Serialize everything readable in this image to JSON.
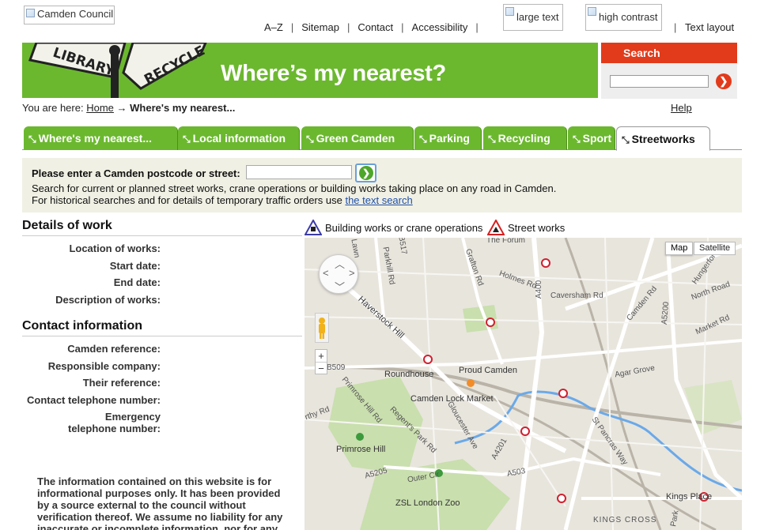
{
  "header": {
    "logo_alt": "Camden Council",
    "util_links": [
      "A–Z",
      "Sitemap",
      "Contact",
      "Accessibility"
    ],
    "large_text_alt": "large text",
    "high_contrast_alt": "high contrast",
    "text_layout": "Text layout"
  },
  "banner": {
    "sign_words": [
      "LIBRARY",
      "RECYCLE"
    ],
    "title": "Where’s my nearest?"
  },
  "search": {
    "heading": "Search",
    "placeholder": "",
    "go_glyph": "❯"
  },
  "breadcrumb": {
    "prefix": "You are here:",
    "home": "Home",
    "arrow": "→",
    "current": "Where's my nearest..."
  },
  "help": "Help",
  "tabs": [
    {
      "label": "Where's my nearest...",
      "active": false
    },
    {
      "label": "Local information",
      "active": false
    },
    {
      "label": "Green Camden",
      "active": false
    },
    {
      "label": "Parking",
      "active": false
    },
    {
      "label": "Recycling",
      "active": false
    },
    {
      "label": "Sport",
      "active": false
    },
    {
      "label": "Streetworks",
      "active": true
    }
  ],
  "postcode": {
    "label": "Please enter a Camden postcode or street:",
    "value": "",
    "desc1": "Search for current or planned street works, crane operations or building works taking place on any road in Camden.",
    "desc2_prefix": "For historical searches and for details of temporary traffic orders use",
    "desc2_link": "the text search"
  },
  "details": {
    "title": "Details of work",
    "fields": [
      "Location of works:",
      "Start date:",
      "End date:",
      "Description of works:"
    ]
  },
  "contact": {
    "title": "Contact information",
    "fields": [
      "Camden reference:",
      "Responsible company:",
      "Their reference:",
      "Contact telephone number:",
      "Emergency telephone number:"
    ]
  },
  "disclaimer": "The information contained on this website is for informational purposes only. It has been provided by a source external to the council without verification thereof. We assume no liability for any inaccurate or incomplete information, nor for any",
  "legend": {
    "building": "Building works or crane operations",
    "street": "Street works",
    "colors": {
      "building": "#3c3ca8",
      "street": "#d62020"
    }
  },
  "map": {
    "type_map": "Map",
    "type_satellite": "Satellite",
    "zoom_in": "+",
    "zoom_out": "−",
    "labels": [
      "The Forum",
      "Parkhill Rd",
      "B517",
      "Grafton Rd",
      "Holmes Rd",
      "Caversham Rd",
      "A400",
      "Haverstock Hill",
      "Camden Rd",
      "North Road",
      "Hungerford",
      "A5200",
      "Market Rd",
      "B509",
      "Roundhouse",
      "Proud Camden",
      "Agar Grove",
      "Camden Lock Market",
      "Primrose Hill Rd",
      "Regent's Park Rd",
      "Gloucester Ave",
      "A4201",
      "St Pancras Way",
      "Primrose Hill",
      "A5205",
      "Outer Cir",
      "A503",
      "ZSL London Zoo",
      "Kings Place",
      "KINGS CROSS",
      "Lawn",
      "rthy Rd",
      "Park"
    ]
  },
  "colors": {
    "brand_green": "#6bb82f",
    "search_red": "#e23b1b",
    "panel_bg": "#f0f0e4",
    "link_blue": "#1f4fa8"
  }
}
